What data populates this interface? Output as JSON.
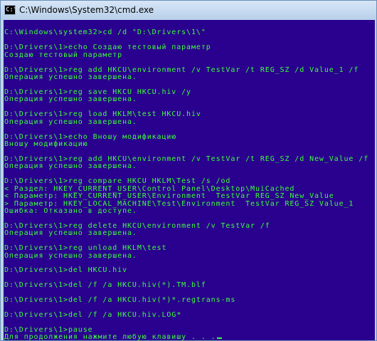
{
  "window": {
    "title": "C:\\Windows\\System32\\cmd.exe",
    "icon_label": "C:\\"
  },
  "console": {
    "lines": [
      "",
      "C:\\Windows\\system32>cd /d \"D:\\Drivers\\1\\\"",
      "",
      "D:\\Drivers\\1>echo Создаю тестовый параметр",
      "Создаю тестовый параметр",
      "",
      "D:\\Drivers\\1>reg add HKCU\\environment /v TestVar /t REG_SZ /d Value_1 /f",
      "Операция успешно завершена.",
      "",
      "D:\\Drivers\\1>reg save HKCU HKCU.hiv /y",
      "Операция успешно завершена.",
      "",
      "D:\\Drivers\\1>reg load HKLM\\test HKCU.hiv",
      "Операция успешно завершена.",
      "",
      "D:\\Drivers\\1>echo Вношу модификацию",
      "Вношу модификацию",
      "",
      "D:\\Drivers\\1>reg add HKCU\\environment /v TestVar /t REG_SZ /d New_Value /f",
      "Операция успешно завершена.",
      "",
      "D:\\Drivers\\1>reg compare HKCU HKLM\\Test /s /od",
      "< Раздел: HKEY_CURRENT_USER\\Control Panel\\Desktop\\MuiCached",
      "< Параметр: HKEY_CURRENT_USER\\Environment  TestVar REG_SZ New_Value",
      "> Параметр: HKEY_LOCAL_MACHINE\\Test\\Environment  TestVar REG_SZ Value_1",
      "Ошибка: Отказано в доступе.",
      "",
      "D:\\Drivers\\1>reg delete HKCU\\environment /v TestVar /f",
      "Операция успешно завершена.",
      "",
      "D:\\Drivers\\1>reg unload HKLM\\test",
      "Операция успешно завершена.",
      "",
      "D:\\Drivers\\1>del HKCU.hiv",
      "",
      "D:\\Drivers\\1>del /f /a HKCU.hiv(*).TM.blf",
      "",
      "D:\\Drivers\\1>del /f /a HKCU.hiv(*)*.regtrans-ms",
      "",
      "D:\\Drivers\\1>del /f /a HKCU.hiv.LOG*",
      "",
      "D:\\Drivers\\1>pause",
      "Для продолжения нажмите любую клавишу . . ."
    ]
  },
  "colors": {
    "console_background": "#2a008e",
    "console_text": "#3cff3c",
    "titlebar": "#bcd3ec"
  }
}
